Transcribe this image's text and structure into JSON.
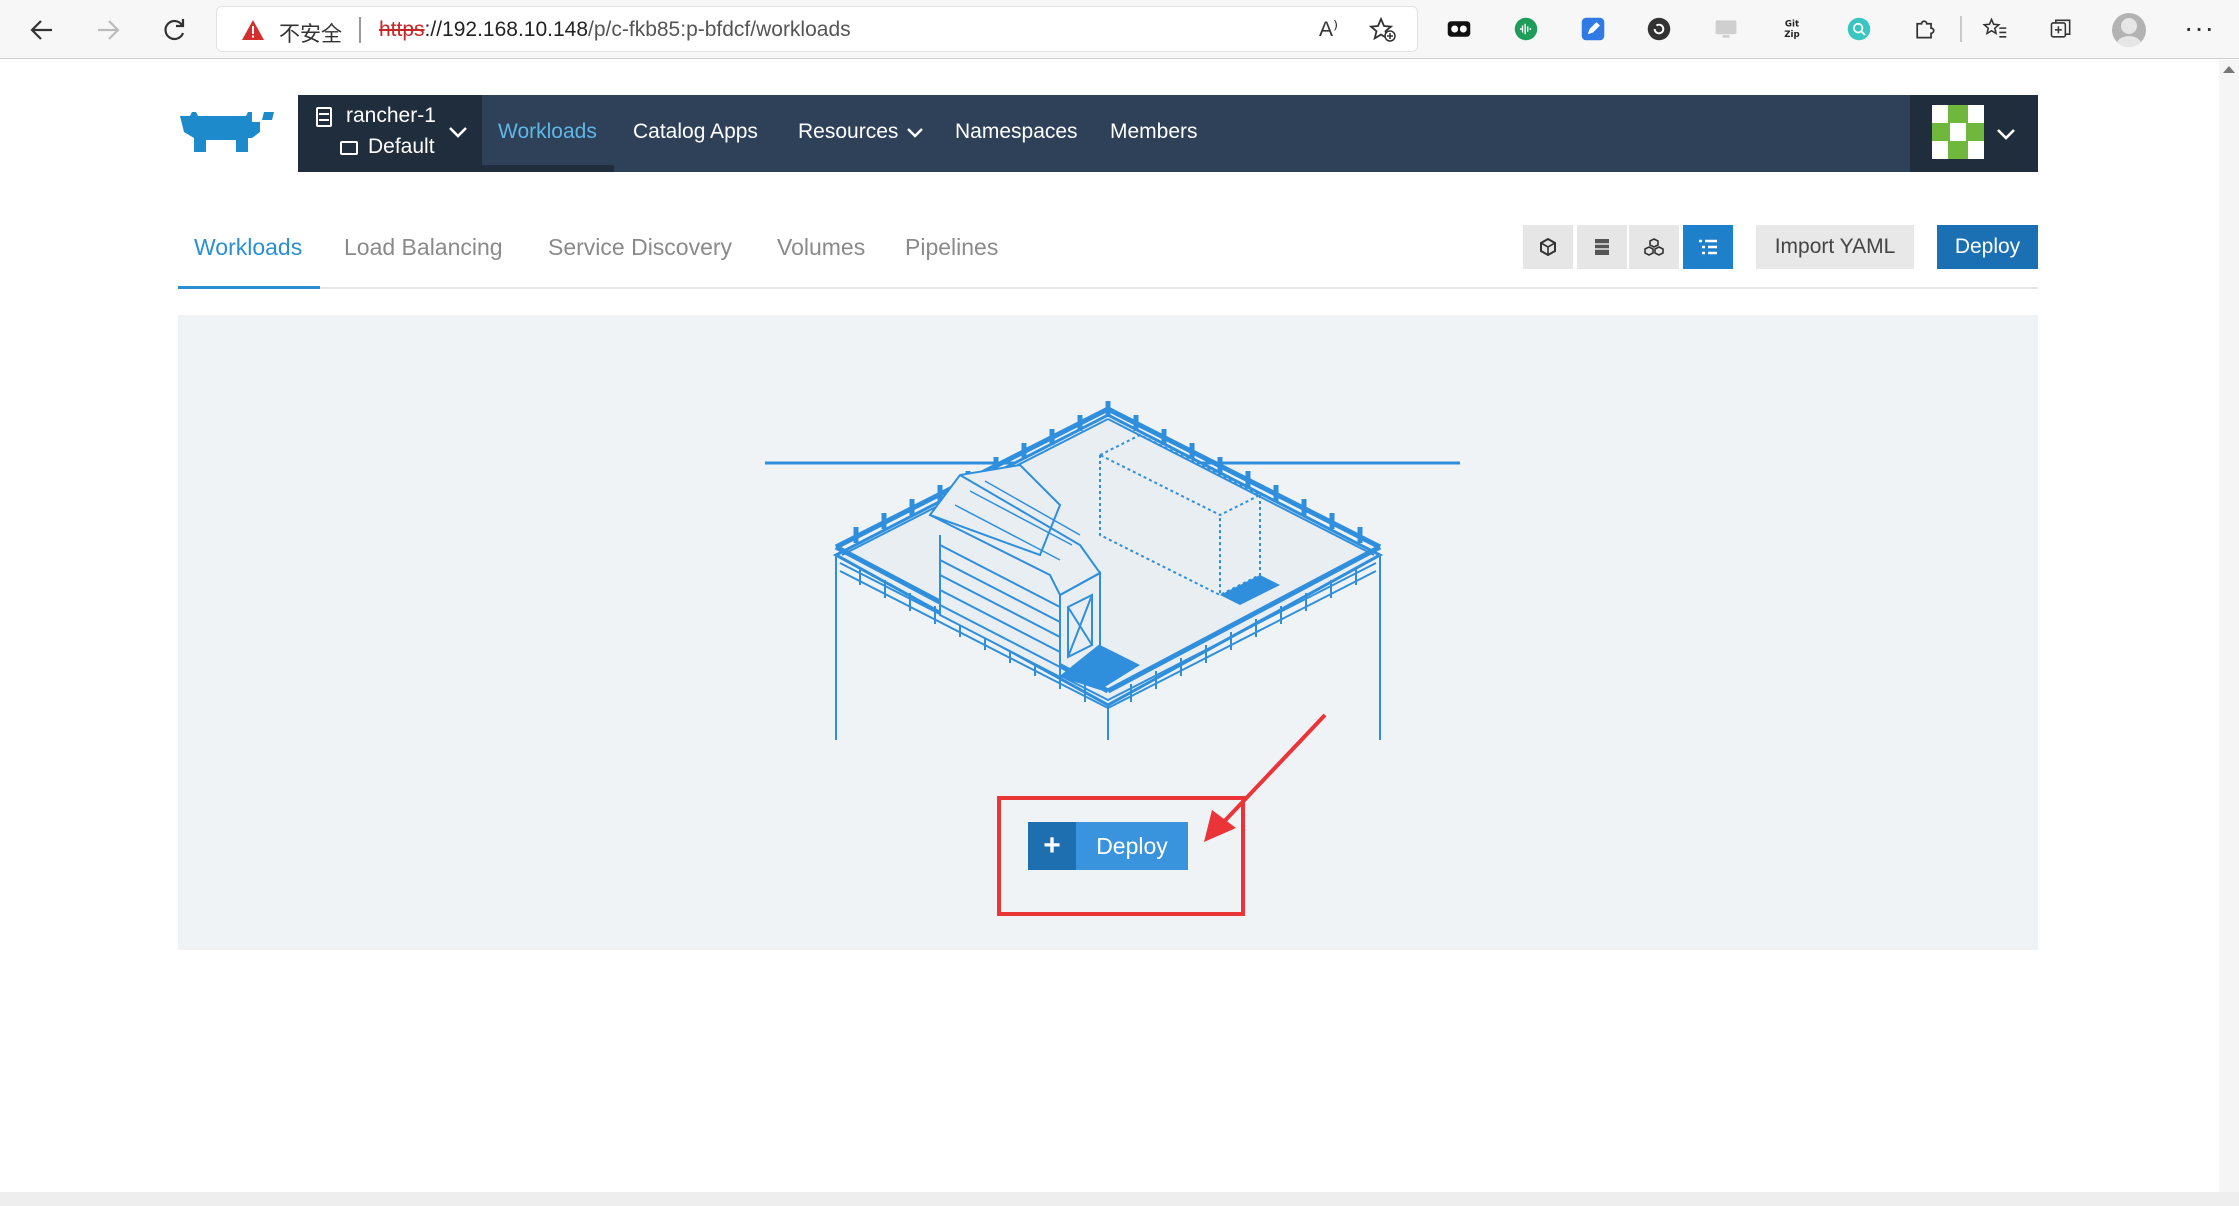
{
  "browser": {
    "insecure_label": "不安全",
    "url_scheme": "https",
    "url_host": "://192.168.10.148",
    "url_path": "/p/c-fkb85:p-bfdcf/workloads",
    "read_aloud_icon": "A⁾",
    "more_label": "···"
  },
  "header": {
    "cluster_name": "rancher-1",
    "project_name": "Default",
    "nav": [
      "Workloads",
      "Catalog Apps",
      "Resources",
      "Namespaces",
      "Members"
    ]
  },
  "subnav": {
    "tabs": [
      "Workloads",
      "Load Balancing",
      "Service Discovery",
      "Volumes",
      "Pipelines"
    ],
    "import_label": "Import YAML",
    "deploy_label": "Deploy"
  },
  "empty_state": {
    "deploy_label": "Deploy",
    "plus": "+"
  },
  "colors": {
    "header_bg": "#2e4159",
    "accent": "#2a8fd0",
    "deploy_btn": "#1b6fb3",
    "annotation": "#ea3438"
  }
}
